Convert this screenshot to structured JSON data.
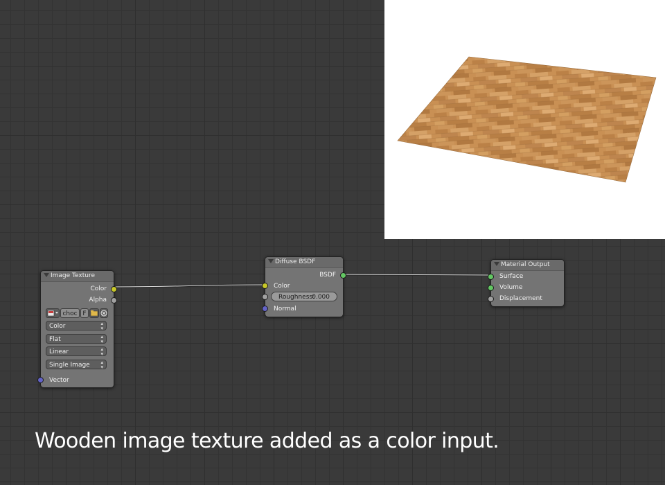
{
  "caption": "Wooden image texture added as a color input.",
  "colors": {
    "background": "#3a3a3a",
    "node_body": "#747474",
    "socket_color": "#c8c829",
    "socket_float": "#a1a1a1",
    "socket_vector": "#6363c7",
    "socket_shader": "#63c763",
    "wood": "#c68a4a"
  },
  "nodes": {
    "image_texture": {
      "title": "Image Texture",
      "outputs": [
        "Color",
        "Alpha"
      ],
      "image_name": "choc",
      "fake_user_label": "F",
      "image_icon": "image-icon",
      "open_icon": "folder-icon",
      "unlink_icon": "close-icon",
      "color_space": "Color",
      "projection": "Flat",
      "interpolation": "Linear",
      "source": "Single Image",
      "inputs": [
        "Vector"
      ]
    },
    "diffuse_bsdf": {
      "title": "Diffuse BSDF",
      "output": "BSDF",
      "inputs": {
        "color": "Color",
        "roughness_label": "Roughness:",
        "roughness_value": "0.000",
        "normal": "Normal"
      }
    },
    "material_output": {
      "title": "Material Output",
      "inputs": [
        "Surface",
        "Volume",
        "Displacement"
      ]
    }
  }
}
